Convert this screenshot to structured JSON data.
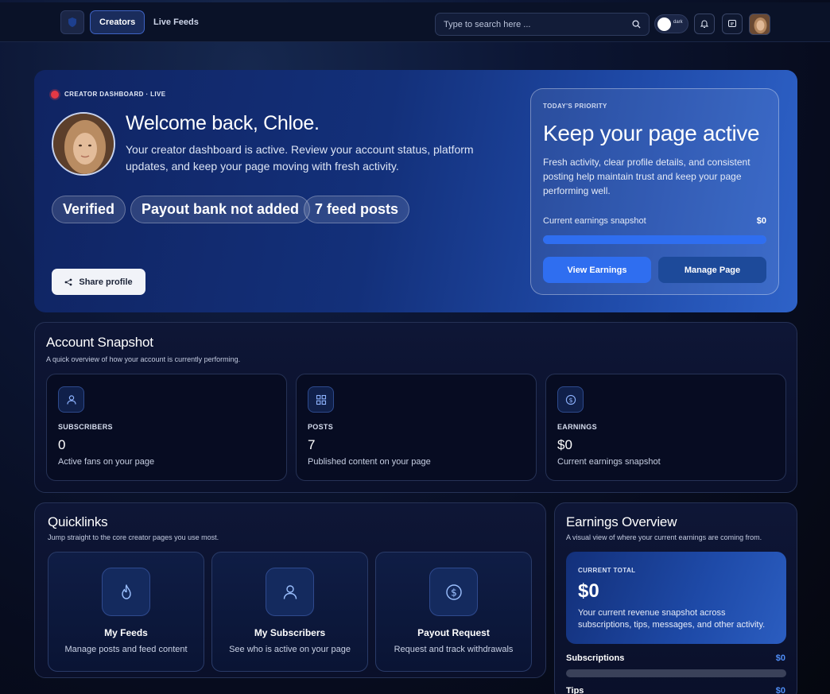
{
  "nav": {
    "tabs": [
      {
        "label": "Creators",
        "active": true
      },
      {
        "label": "Live Feeds",
        "active": false
      }
    ],
    "search_placeholder": "Type to search here ...",
    "theme_toggle_label": "dark",
    "icons": [
      "logo-icon",
      "search-icon",
      "bell-icon",
      "message-icon"
    ]
  },
  "hero": {
    "status_label": "CREATOR DASHBOARD · LIVE",
    "greeting": "Welcome back, Chloe.",
    "description": "Your creator dashboard is active. Review your account status, platform updates, and keep your page moving with fresh activity.",
    "pills": [
      "Verified",
      "Payout bank not added",
      "7 feed posts"
    ],
    "share_button": "Share profile"
  },
  "priority": {
    "eyebrow": "TODAY'S PRIORITY",
    "title": "Keep your page active",
    "description": "Fresh activity, clear profile details, and consistent posting help maintain trust and keep your page performing well.",
    "snapshot_label": "Current earnings snapshot",
    "snapshot_value": "$0",
    "progress_fraction": 1.0,
    "buttons": {
      "earnings": "View Earnings",
      "manage": "Manage Page"
    }
  },
  "snapshot": {
    "title": "Account Snapshot",
    "subtitle": "A quick overview of how your account is currently performing.",
    "cards": [
      {
        "icon": "user-icon",
        "label": "SUBSCRIBERS",
        "value": "0",
        "desc": "Active fans on your page"
      },
      {
        "icon": "grid-icon",
        "label": "POSTS",
        "value": "7",
        "desc": "Published content on your page"
      },
      {
        "icon": "dollar-icon",
        "label": "EARNINGS",
        "value": "$0",
        "desc": "Current earnings snapshot"
      }
    ]
  },
  "quicklinks": {
    "title": "Quicklinks",
    "subtitle": "Jump straight to the core creator pages you use most.",
    "links": [
      {
        "icon": "flame-icon",
        "title": "My Feeds",
        "desc": "Manage posts and feed content"
      },
      {
        "icon": "user-icon",
        "title": "My Subscribers",
        "desc": "See who is active on your page"
      },
      {
        "icon": "dollar-icon",
        "title": "Payout Request",
        "desc": "Request and track withdrawals"
      }
    ]
  },
  "earnings": {
    "title": "Earnings Overview",
    "subtitle": "A visual view of where your current earnings are coming from.",
    "current_label": "CURRENT TOTAL",
    "current_value": "$0",
    "current_desc": "Your current revenue snapshot across subscriptions, tips, messages, and other activity.",
    "breakdown": [
      {
        "label": "Subscriptions",
        "value": "$0",
        "fraction": 0
      },
      {
        "label": "Tips",
        "value": "$0",
        "fraction": 0
      }
    ]
  },
  "colors": {
    "accent": "#2f6ef0",
    "live": "#e53945",
    "breakdown_value": "#4f8ef7"
  }
}
